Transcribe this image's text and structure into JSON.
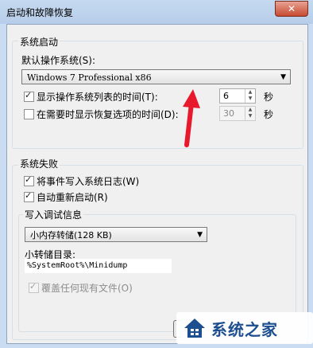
{
  "window": {
    "title": "启动和故障恢复",
    "close_glyph": "✕"
  },
  "system_startup": {
    "group_label": "系统启动",
    "default_os_label": "默认操作系统(S):",
    "default_os_value": "Windows 7 Professional x86",
    "show_list": {
      "label": "显示操作系统列表的时间(T):",
      "checked": true,
      "value": "6",
      "unit": "秒"
    },
    "show_recovery": {
      "label": "在需要时显示恢复选项的时间(D):",
      "checked": false,
      "value": "30",
      "unit": "秒"
    }
  },
  "system_failure": {
    "group_label": "系统失败",
    "write_event": {
      "label": "将事件写入系统日志(W)",
      "checked": true
    },
    "auto_restart": {
      "label": "自动重新启动(R)",
      "checked": true
    },
    "debug_group_label": "写入调试信息",
    "debug_type_value": "小内存转储(128 KB)",
    "dump_dir_label": "小转储目录:",
    "dump_dir_value": "%SystemRoot%\\Minidump",
    "overwrite": {
      "label": "覆盖任何现有文件(O)",
      "checked": true,
      "enabled": false
    }
  },
  "watermark": {
    "text": "系统之家"
  },
  "colors": {
    "annotation_arrow": "#e8192c",
    "watermark_text": "#1d4e8f"
  }
}
